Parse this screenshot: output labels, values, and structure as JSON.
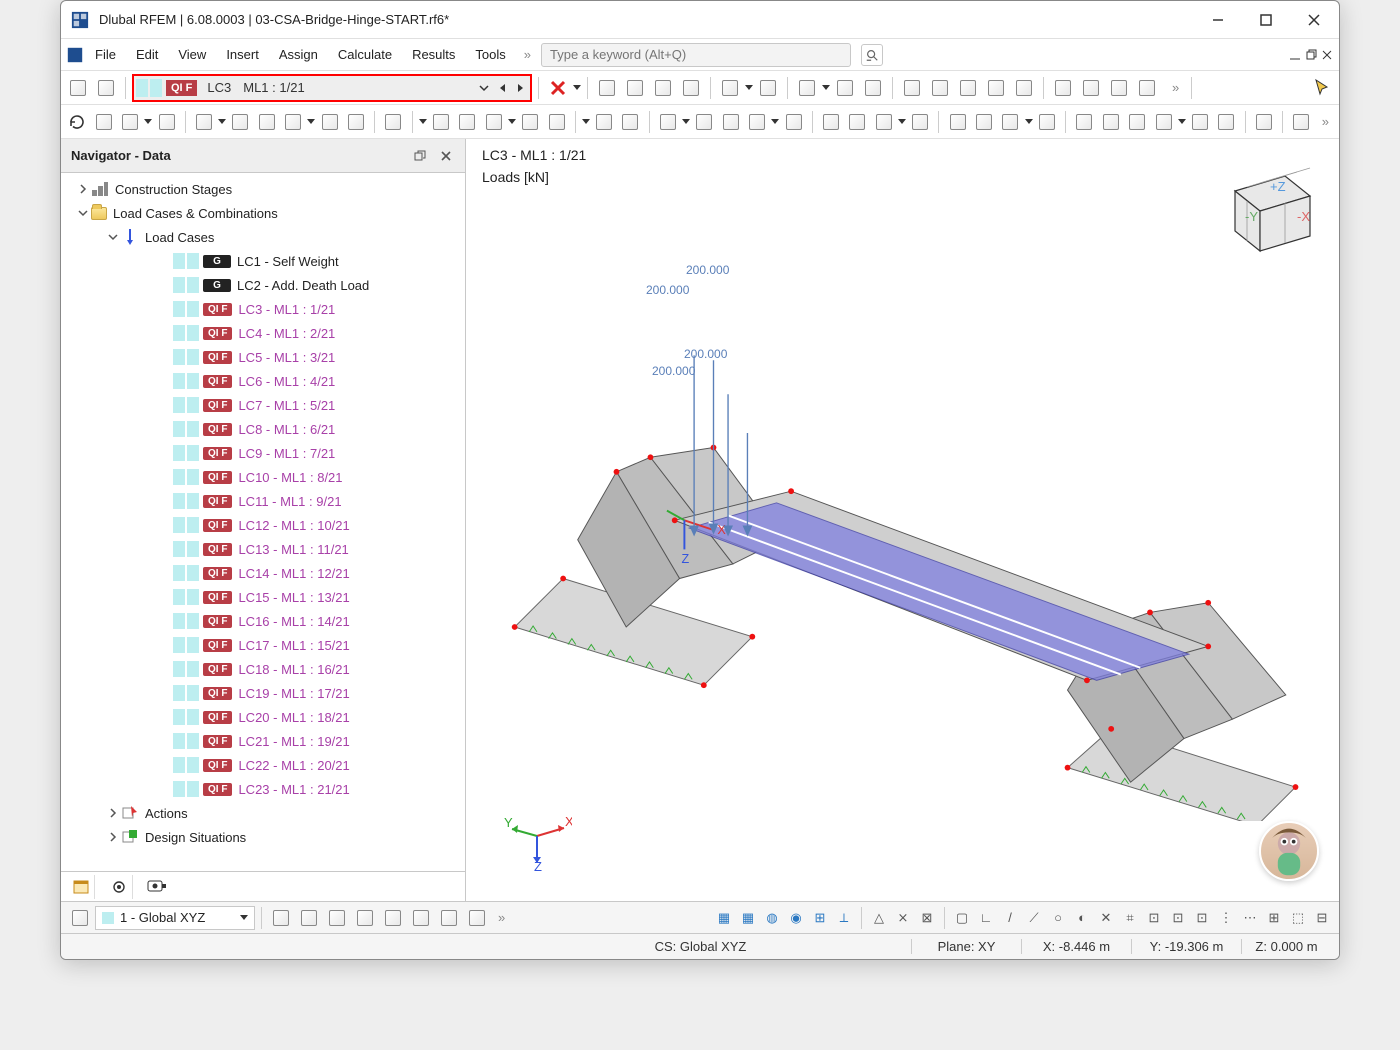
{
  "title": "Dlubal RFEM | 6.08.0003 | 03-CSA-Bridge-Hinge-START.rf6*",
  "menu": [
    "File",
    "Edit",
    "View",
    "Insert",
    "Assign",
    "Calculate",
    "Results",
    "Tools"
  ],
  "search": {
    "placeholder": "Type a keyword (Alt+Q)"
  },
  "lc_selector": {
    "badge": "QI F",
    "lc": "LC3",
    "text": "ML1 : 1/21"
  },
  "navigator": {
    "title": "Navigator - Data",
    "nodes": [
      {
        "type": "group",
        "depth": 0,
        "expander": "right",
        "icon": "stages",
        "label": "Construction Stages"
      },
      {
        "type": "group",
        "depth": 1,
        "expander": "down",
        "icon": "folder",
        "label": "Load Cases & Combinations"
      },
      {
        "type": "group",
        "depth": 2,
        "expander": "down",
        "icon": "lc",
        "label": "Load Cases"
      },
      {
        "type": "lc",
        "depth": 3,
        "badge": "G",
        "badgeclass": "g",
        "label": "LC1 - Self Weight",
        "link": false
      },
      {
        "type": "lc",
        "depth": 3,
        "badge": "G",
        "badgeclass": "g",
        "label": "LC2 - Add. Death Load",
        "link": false
      },
      {
        "type": "lc",
        "depth": 3,
        "badge": "QI F",
        "badgeclass": "qi",
        "label": "LC3 - ML1 : 1/21",
        "link": true
      },
      {
        "type": "lc",
        "depth": 3,
        "badge": "QI F",
        "badgeclass": "qi",
        "label": "LC4 - ML1 : 2/21",
        "link": true
      },
      {
        "type": "lc",
        "depth": 3,
        "badge": "QI F",
        "badgeclass": "qi",
        "label": "LC5 - ML1 : 3/21",
        "link": true
      },
      {
        "type": "lc",
        "depth": 3,
        "badge": "QI F",
        "badgeclass": "qi",
        "label": "LC6 - ML1 : 4/21",
        "link": true
      },
      {
        "type": "lc",
        "depth": 3,
        "badge": "QI F",
        "badgeclass": "qi",
        "label": "LC7 - ML1 : 5/21",
        "link": true
      },
      {
        "type": "lc",
        "depth": 3,
        "badge": "QI F",
        "badgeclass": "qi",
        "label": "LC8 - ML1 : 6/21",
        "link": true
      },
      {
        "type": "lc",
        "depth": 3,
        "badge": "QI F",
        "badgeclass": "qi",
        "label": "LC9 - ML1 : 7/21",
        "link": true
      },
      {
        "type": "lc",
        "depth": 3,
        "badge": "QI F",
        "badgeclass": "qi",
        "label": "LC10 - ML1 : 8/21",
        "link": true
      },
      {
        "type": "lc",
        "depth": 3,
        "badge": "QI F",
        "badgeclass": "qi",
        "label": "LC11 - ML1 : 9/21",
        "link": true
      },
      {
        "type": "lc",
        "depth": 3,
        "badge": "QI F",
        "badgeclass": "qi",
        "label": "LC12 - ML1 : 10/21",
        "link": true
      },
      {
        "type": "lc",
        "depth": 3,
        "badge": "QI F",
        "badgeclass": "qi",
        "label": "LC13 - ML1 : 11/21",
        "link": true
      },
      {
        "type": "lc",
        "depth": 3,
        "badge": "QI F",
        "badgeclass": "qi",
        "label": "LC14 - ML1 : 12/21",
        "link": true
      },
      {
        "type": "lc",
        "depth": 3,
        "badge": "QI F",
        "badgeclass": "qi",
        "label": "LC15 - ML1 : 13/21",
        "link": true
      },
      {
        "type": "lc",
        "depth": 3,
        "badge": "QI F",
        "badgeclass": "qi",
        "label": "LC16 - ML1 : 14/21",
        "link": true
      },
      {
        "type": "lc",
        "depth": 3,
        "badge": "QI F",
        "badgeclass": "qi",
        "label": "LC17 - ML1 : 15/21",
        "link": true
      },
      {
        "type": "lc",
        "depth": 3,
        "badge": "QI F",
        "badgeclass": "qi",
        "label": "LC18 - ML1 : 16/21",
        "link": true
      },
      {
        "type": "lc",
        "depth": 3,
        "badge": "QI F",
        "badgeclass": "qi",
        "label": "LC19 - ML1 : 17/21",
        "link": true
      },
      {
        "type": "lc",
        "depth": 3,
        "badge": "QI F",
        "badgeclass": "qi",
        "label": "LC20 - ML1 : 18/21",
        "link": true
      },
      {
        "type": "lc",
        "depth": 3,
        "badge": "QI F",
        "badgeclass": "qi",
        "label": "LC21 - ML1 : 19/21",
        "link": true
      },
      {
        "type": "lc",
        "depth": 3,
        "badge": "QI F",
        "badgeclass": "qi",
        "label": "LC22 - ML1 : 20/21",
        "link": true
      },
      {
        "type": "lc",
        "depth": 3,
        "badge": "QI F",
        "badgeclass": "qi",
        "label": "LC23 - ML1 : 21/21",
        "link": true
      },
      {
        "type": "group",
        "depth": 2,
        "expander": "right",
        "icon": "actions",
        "label": "Actions"
      },
      {
        "type": "group",
        "depth": 2,
        "expander": "right",
        "icon": "design",
        "label": "Design Situations"
      }
    ]
  },
  "viewport": {
    "title": "LC3 - ML1 : 1/21",
    "subtitle": "Loads [kN]",
    "loads": [
      "200.000",
      "200.000",
      "200.000",
      "200.000"
    ],
    "axis_labels": {
      "x": "X",
      "y": "Y",
      "z": "Z"
    }
  },
  "bottom": {
    "cs_label": "1 - Global XYZ"
  },
  "status": {
    "cs": "CS: Global XYZ",
    "plane": "Plane: XY",
    "x": "X: -8.446 m",
    "y": "Y: -19.306 m",
    "z": "Z: 0.000 m"
  }
}
